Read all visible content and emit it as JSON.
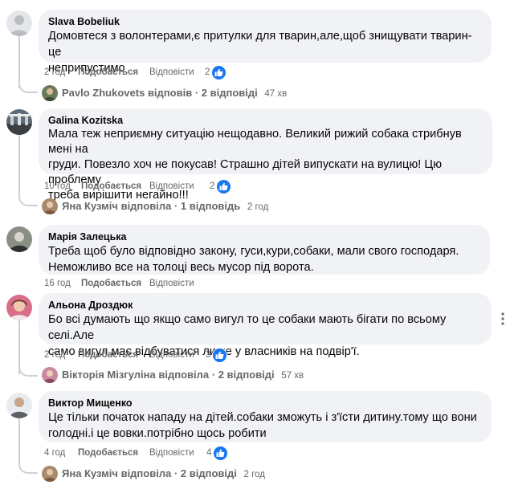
{
  "comments": [
    {
      "author": "Slava Bobeliuk",
      "text": "Домовтеся з волонтерами,є притулки для тварин,але,щоб знищувати тварин-це\nнеприпустимо",
      "time": "2 год",
      "like_label": "Подобається",
      "reply_label": "Відповісти",
      "likes": "2",
      "replies": {
        "name": "Pavlo Zhukovets",
        "verb": "відповів",
        "separator": "·",
        "count_label": "2 відповіді",
        "time": "47 хв"
      }
    },
    {
      "author": "Galina Kozitska",
      "text": "Мала теж неприємну ситуацію нещодавно. Великий рижий собака стрибнув мені на\nгруди. Повезло хоч не покусав! Страшно дітей випускати на вулицю! Цю проблему\nтреба вирішити негайно!!!",
      "time": "10 год",
      "like_label": "Подобається",
      "reply_label": "Відповісти",
      "likes": "2",
      "replies": {
        "name": "Яна Кузміч",
        "verb": "відповіла",
        "separator": "·",
        "count_label": "1 відповідь",
        "time": "2 год"
      }
    },
    {
      "author": "Марія Залецька",
      "text": "Треба щоб було відповідно закону, гуси,кури,собаки, мали свого господаря.\nНеможливо все на толоці весь мусор під ворота.",
      "time": "16 год",
      "like_label": "Подобається",
      "reply_label": "Відповісти",
      "likes": ""
    },
    {
      "author": "Альона Дроздюк",
      "text": "Бо всі думають що якщо само вигул то це собаки мають бігати по всьому селі.Але\nсамо вигул має відбуватися лише у власників на подвір'ї.",
      "time": "2 год",
      "like_label": "Подобається",
      "reply_label": "Відповісти",
      "likes": "3",
      "replies": {
        "name": "Вікторія Мізгуліна",
        "verb": "відповіла",
        "separator": "·",
        "count_label": "2 відповіді",
        "time": "57 хв"
      }
    },
    {
      "author": "Виктор Мищенко",
      "text": "Це тільки початок нападу на дітей.собаки зможуть і з'їсти дитину.тому що вони\nголодні.і це вовки.потрібно щось робити",
      "time": "4 год",
      "like_label": "Подобається",
      "reply_label": "Відповісти",
      "likes": "4",
      "replies": {
        "name": "Яна Кузміч",
        "verb": "відповіла",
        "separator": "·",
        "count_label": "2 відповіді",
        "time": "2 год"
      }
    }
  ],
  "icons": {
    "like": "thumbs-up-icon",
    "more": "more-options-icon"
  },
  "colors": {
    "bubble": "#f0f2f5",
    "secondary_text": "#65676b",
    "like_blue": "#1877f2",
    "thread_line": "#ced0d4"
  }
}
